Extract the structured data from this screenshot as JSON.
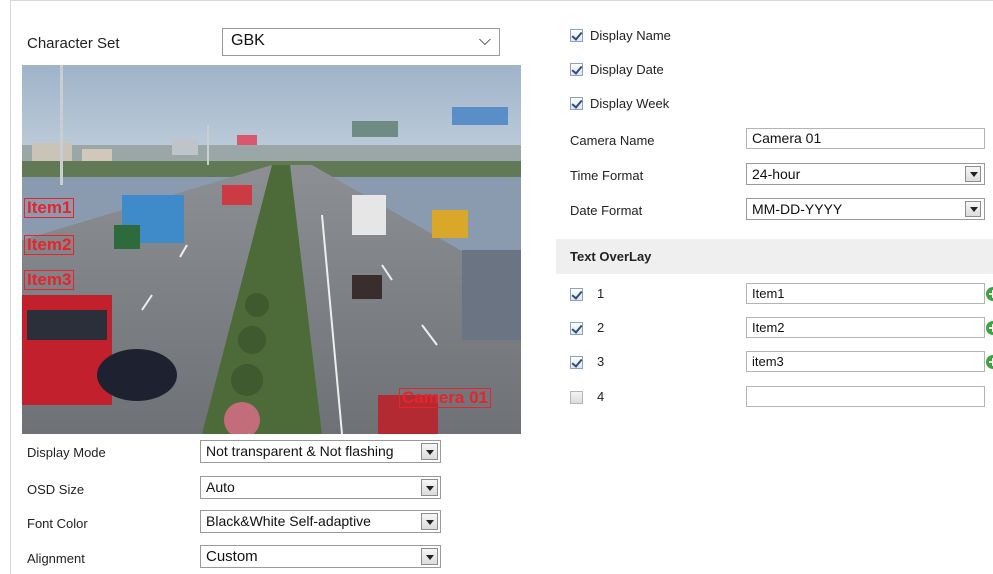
{
  "charset": {
    "label": "Character Set",
    "value": "GBK"
  },
  "video": {
    "overlay_items": [
      "Item1",
      "Item2",
      "Item3"
    ],
    "camera_label": "Camera 01"
  },
  "display_options": [
    {
      "label": "Display Name",
      "checked": true
    },
    {
      "label": "Display Date",
      "checked": true
    },
    {
      "label": "Display Week",
      "checked": true
    }
  ],
  "camera_name": {
    "label": "Camera Name",
    "value": "Camera 01"
  },
  "time_format": {
    "label": "Time Format",
    "value": "24-hour"
  },
  "date_format": {
    "label": "Date Format",
    "value": "MM-DD-YYYY"
  },
  "text_overlay": {
    "title": "Text OverLay",
    "rows": [
      {
        "num": "1",
        "checked": true,
        "value": "Item1"
      },
      {
        "num": "2",
        "checked": true,
        "value": "Item2"
      },
      {
        "num": "3",
        "checked": true,
        "value": "item3"
      },
      {
        "num": "4",
        "checked": false,
        "value": ""
      }
    ]
  },
  "display_mode": {
    "label": "Display Mode",
    "value": "Not transparent & Not flashing"
  },
  "osd_size": {
    "label": "OSD Size",
    "value": "Auto"
  },
  "font_color": {
    "label": "Font Color",
    "value": "Black&White Self-adaptive"
  },
  "alignment": {
    "label": "Alignment",
    "value": "Custom"
  },
  "colors": {
    "osd_red": "#e8232b",
    "add_green": "#3aa63c",
    "check_blue": "#2d4e82"
  }
}
